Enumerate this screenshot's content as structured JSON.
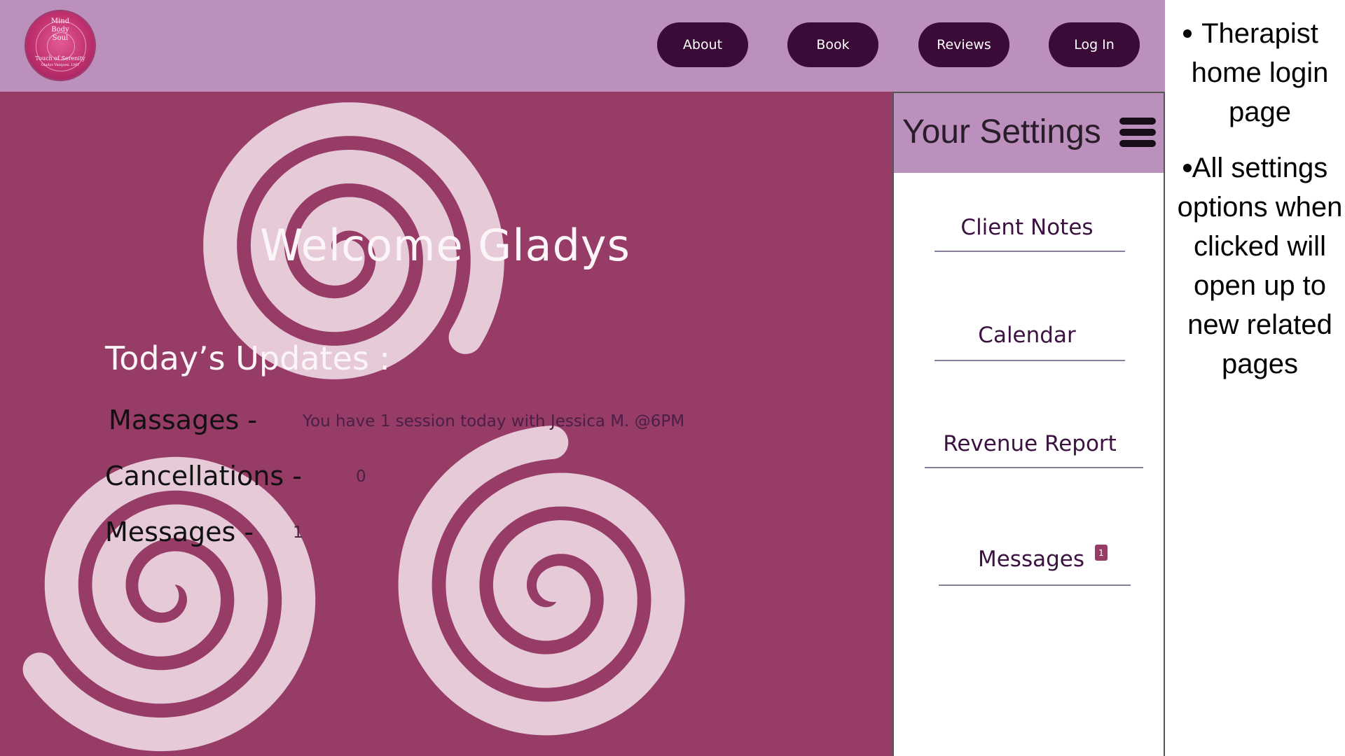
{
  "nav": {
    "logo": {
      "lines": [
        "Mind",
        "Body",
        "Soul",
        "Touch of Serenity",
        "Gladys Vazquez, LMT"
      ]
    },
    "buttons": [
      "About",
      "Book",
      "Reviews",
      "Log In"
    ]
  },
  "main": {
    "welcome": "Welcome Gladys",
    "updates_title": "Today’s Updates :",
    "updates": [
      {
        "label": "Massages -",
        "value": "You have 1 session today with Jessica M. @6PM"
      },
      {
        "label": "Cancellations -",
        "value": "0"
      },
      {
        "label": "Messages -",
        "value": "1"
      }
    ]
  },
  "panel": {
    "title": "Your Settings",
    "items": [
      "Client Notes",
      "Calendar",
      "Revenue Report",
      "Messages"
    ],
    "messages_badge": "1"
  },
  "notes": [
    "Therapist home login page",
    "All settings options when clicked will open up to new related pages"
  ],
  "colors": {
    "nav_bg": "#bb90bd",
    "button_bg": "#3b0b38",
    "main_bg": "#963c67",
    "spiral": "#e6cad8",
    "panel_header": "#bb90bd"
  }
}
